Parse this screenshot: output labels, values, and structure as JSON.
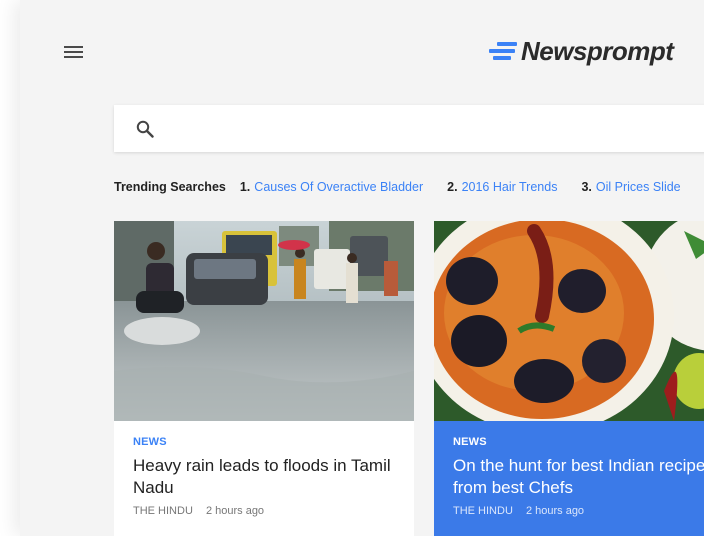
{
  "header": {
    "logo_text": "Newsprompt",
    "menu_icon": "hamburger-menu-icon",
    "logo_icon": "speed-lines-logo-icon"
  },
  "search": {
    "placeholder": "",
    "icon": "search-icon"
  },
  "trending": {
    "label": "Trending Searches",
    "items": [
      {
        "number": "1.",
        "text": "Causes Of Overactive Bladder"
      },
      {
        "number": "2.",
        "text": "2016 Hair Trends"
      },
      {
        "number": "3.",
        "text": "Oil Prices Slide"
      }
    ]
  },
  "cards": [
    {
      "category": "NEWS",
      "title": "Heavy rain leads to floods in Tamil Nadu",
      "source": "THE HINDU",
      "time": "2 hours ago",
      "image": "flooded-street-photo"
    },
    {
      "category": "NEWS",
      "title": "On the hunt for best Indian recipes from best Chefs",
      "source": "THE HINDU",
      "time": "2 hours ago",
      "image": "indian-curry-dish-photo"
    }
  ],
  "colors": {
    "accent": "#3b82f6",
    "highlight_card": "#3b7ae8",
    "app_background": "#f4f4f4"
  }
}
